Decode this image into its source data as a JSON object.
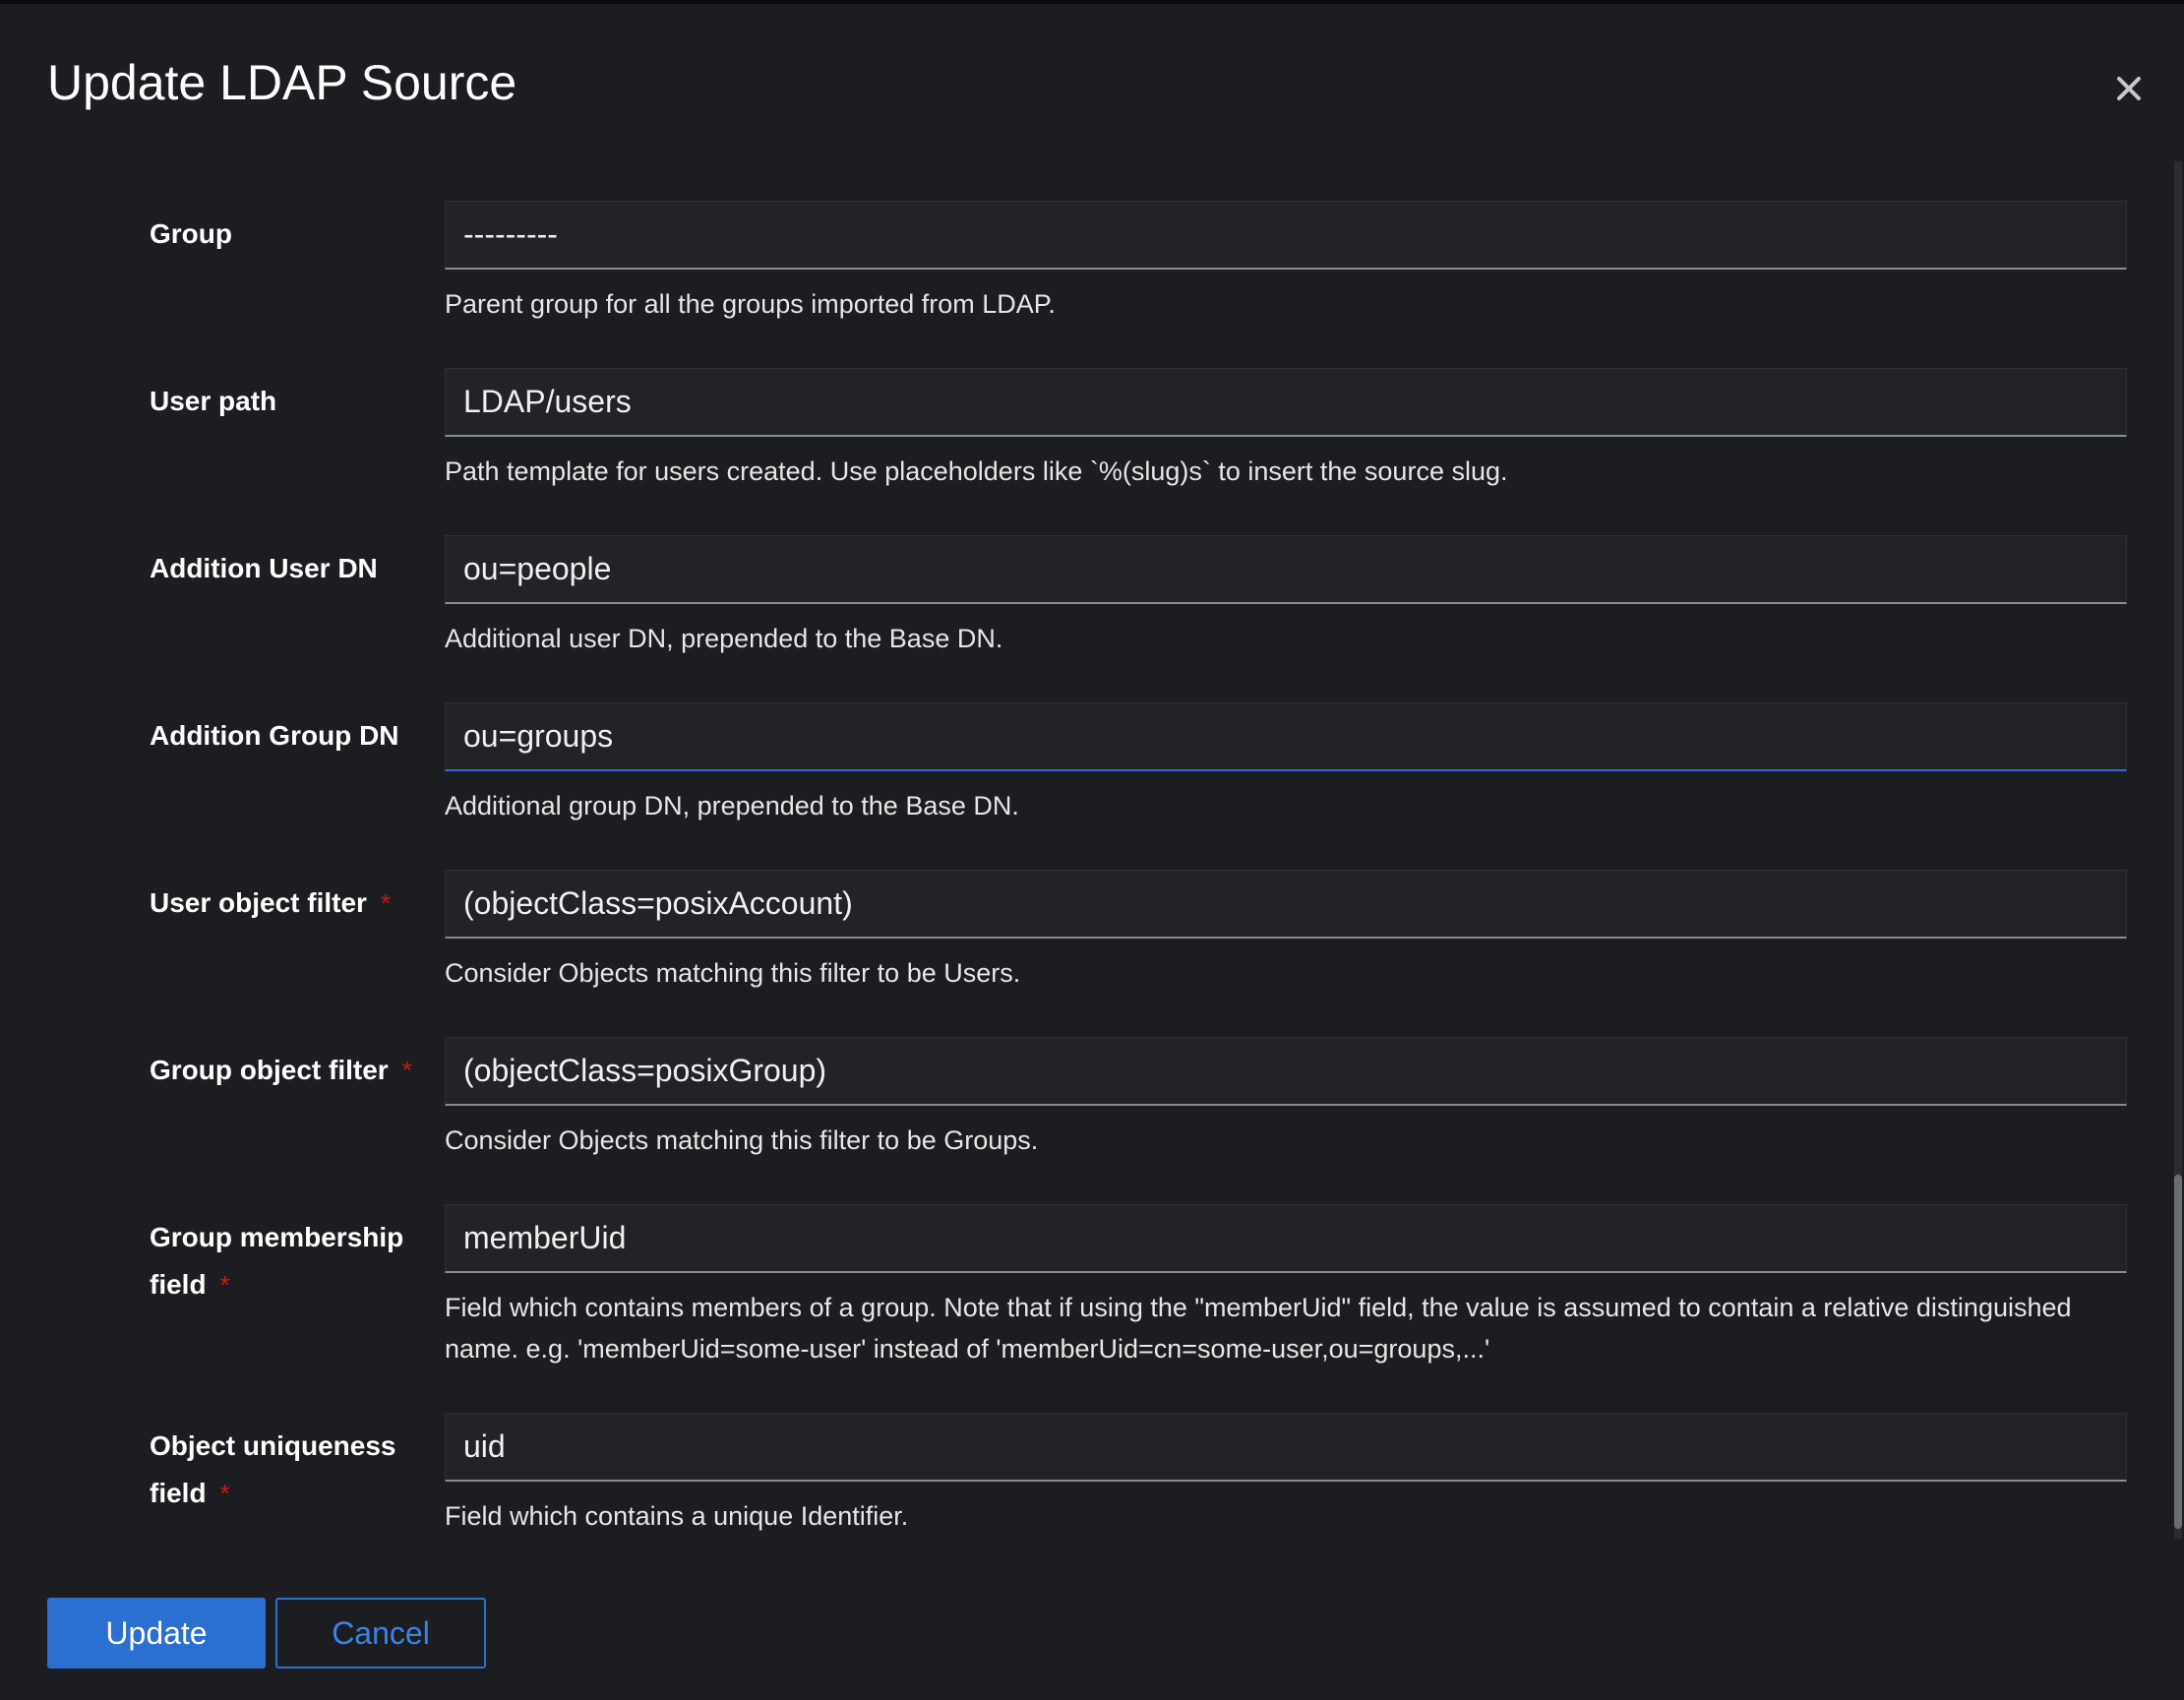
{
  "modal": {
    "title": "Update LDAP Source",
    "close_symbol": "×"
  },
  "fields": [
    {
      "label": "Group",
      "required": false,
      "value": "---------",
      "help": "Parent group for all the groups imported from LDAP."
    },
    {
      "label": "User path",
      "required": false,
      "value": "LDAP/users",
      "help": "Path template for users created. Use placeholders like `%(slug)s` to insert the source slug."
    },
    {
      "label": "Addition User DN",
      "required": false,
      "value": "ou=people",
      "help": "Additional user DN, prepended to the Base DN."
    },
    {
      "label": "Addition Group DN",
      "required": false,
      "value": "ou=groups",
      "help": "Additional group DN, prepended to the Base DN.",
      "focused": true
    },
    {
      "label": "User object filter",
      "required": true,
      "value": "(objectClass=posixAccount)",
      "help": "Consider Objects matching this filter to be Users."
    },
    {
      "label": "Group object filter",
      "required": true,
      "value": "(objectClass=posixGroup)",
      "help": "Consider Objects matching this filter to be Groups."
    },
    {
      "label": "Group membership field",
      "required": true,
      "value": "memberUid",
      "help": "Field which contains members of a group. Note that if using the \"memberUid\" field, the value is assumed to contain a relative distinguished name. e.g. 'memberUid=some-user' instead of 'memberUid=cn=some-user,ou=groups,...'"
    },
    {
      "label": "Object uniqueness field",
      "required": true,
      "value": "uid",
      "help": "Field which contains a unique Identifier."
    }
  ],
  "required_symbol": "*",
  "actions": {
    "update_label": "Update",
    "cancel_label": "Cancel"
  },
  "colors": {
    "primary": "#2b6fd1",
    "required": "#c9190b",
    "background": "#1b1d21"
  }
}
